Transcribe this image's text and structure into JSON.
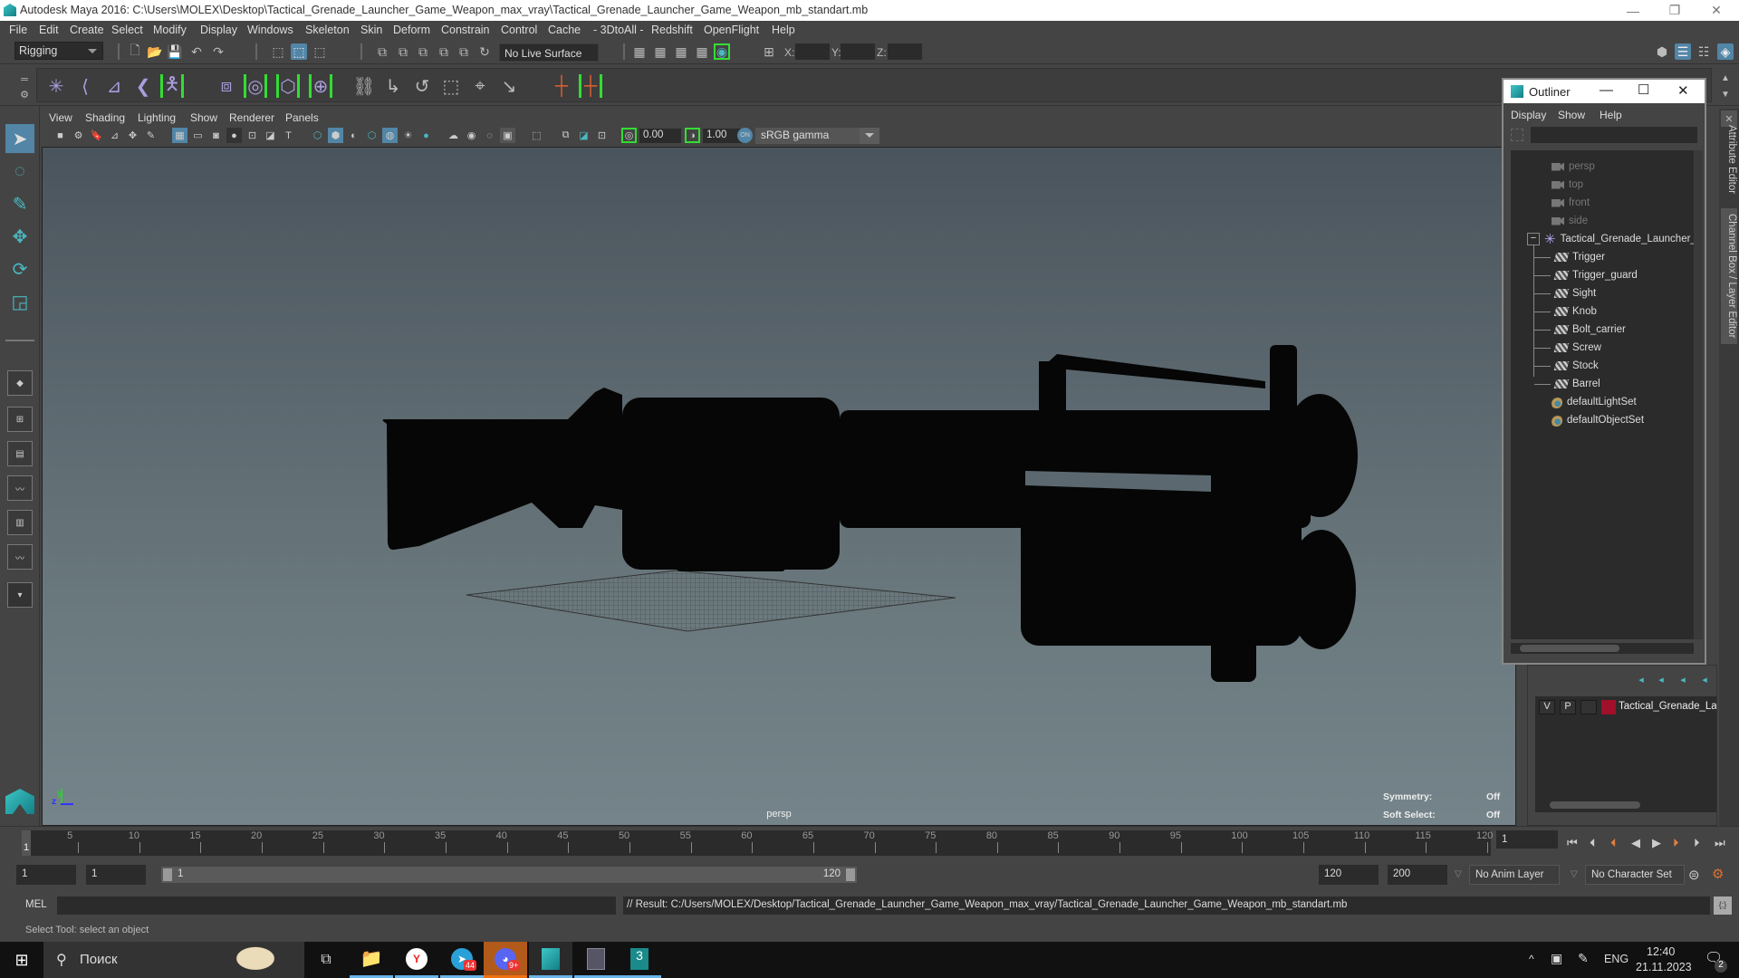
{
  "window": {
    "title": "Autodesk Maya 2016: C:\\Users\\MOLEX\\Desktop\\Tactical_Grenade_Launcher_Game_Weapon_max_vray\\Tactical_Grenade_Launcher_Game_Weapon_mb_standart.mb",
    "minimize": "—",
    "restore": "❐",
    "close": "✕"
  },
  "menubar": [
    "File",
    "Edit",
    "Create",
    "Select",
    "Modify",
    "Display",
    "Windows",
    "Skeleton",
    "Skin",
    "Deform",
    "Constrain",
    "Control",
    "Cache",
    "- 3DtoAll -",
    "Redshift",
    "OpenFlight",
    "Help"
  ],
  "statusline": {
    "mode": "Rigging",
    "live_surface": "No Live Surface",
    "x_label": "X:",
    "y_label": "Y:",
    "z_label": "Z:",
    "x_value": "",
    "y_value": "",
    "z_value": ""
  },
  "panel": {
    "menu": [
      "View",
      "Shading",
      "Lighting",
      "Show",
      "Renderer",
      "Panels"
    ],
    "exposure": "0.00",
    "gamma_value": "1.00",
    "color_space": "sRGB gamma",
    "camera_label": "persp",
    "hud": {
      "symmetry_label": "Symmetry:",
      "symmetry_value": "Off",
      "soft_select_label": "Soft Select:",
      "soft_select_value": "Off"
    },
    "axis": {
      "y": "y",
      "z": "z"
    }
  },
  "outliner": {
    "title": "Outliner",
    "menu": [
      "Display",
      "Show",
      "Help"
    ],
    "search_value": "",
    "cameras": [
      "persp",
      "top",
      "front",
      "side"
    ],
    "group": "Tactical_Grenade_Launcher_",
    "children": [
      "Trigger",
      "Trigger_guard",
      "Sight",
      "Knob",
      "Bolt_carrier",
      "Screw",
      "Stock",
      "Barrel"
    ],
    "sets": [
      "defaultLightSet",
      "defaultObjectSet"
    ]
  },
  "layer_editor": {
    "layers": [
      {
        "visible": "V",
        "playback": "P",
        "name": "Tactical_Grenade_Laur",
        "color": "#a0102a"
      }
    ]
  },
  "side_tabs": [
    "Attribute Editor",
    "Channel Box / Layer Editor"
  ],
  "timeslider": {
    "ticks": [
      "5",
      "10",
      "15",
      "20",
      "25",
      "30",
      "35",
      "40",
      "45",
      "50",
      "55",
      "60",
      "65",
      "70",
      "75",
      "80",
      "85",
      "90",
      "95",
      "100",
      "105",
      "110",
      "115",
      "120"
    ],
    "current_frame": "1",
    "current_frame_field": "1"
  },
  "range": {
    "start": "1",
    "playback_start": "1",
    "slider_start": "1",
    "slider_end": "120",
    "playback_end": "120",
    "end": "200",
    "anim_layer": "No Anim Layer",
    "character_set": "No Character Set"
  },
  "command": {
    "lang": "MEL",
    "input": "",
    "result": "// Result: C:/Users/MOLEX/Desktop/Tactical_Grenade_Launcher_Game_Weapon_max_vray/Tactical_Grenade_Launcher_Game_Weapon_mb_standart.mb"
  },
  "helpline": "Select Tool: select an object",
  "taskbar": {
    "search_placeholder": "Поиск",
    "lang": "ENG",
    "time": "12:40",
    "date": "21.11.2023",
    "notifications": "2",
    "telegram_badge": "44",
    "discord_badge": "9+"
  }
}
